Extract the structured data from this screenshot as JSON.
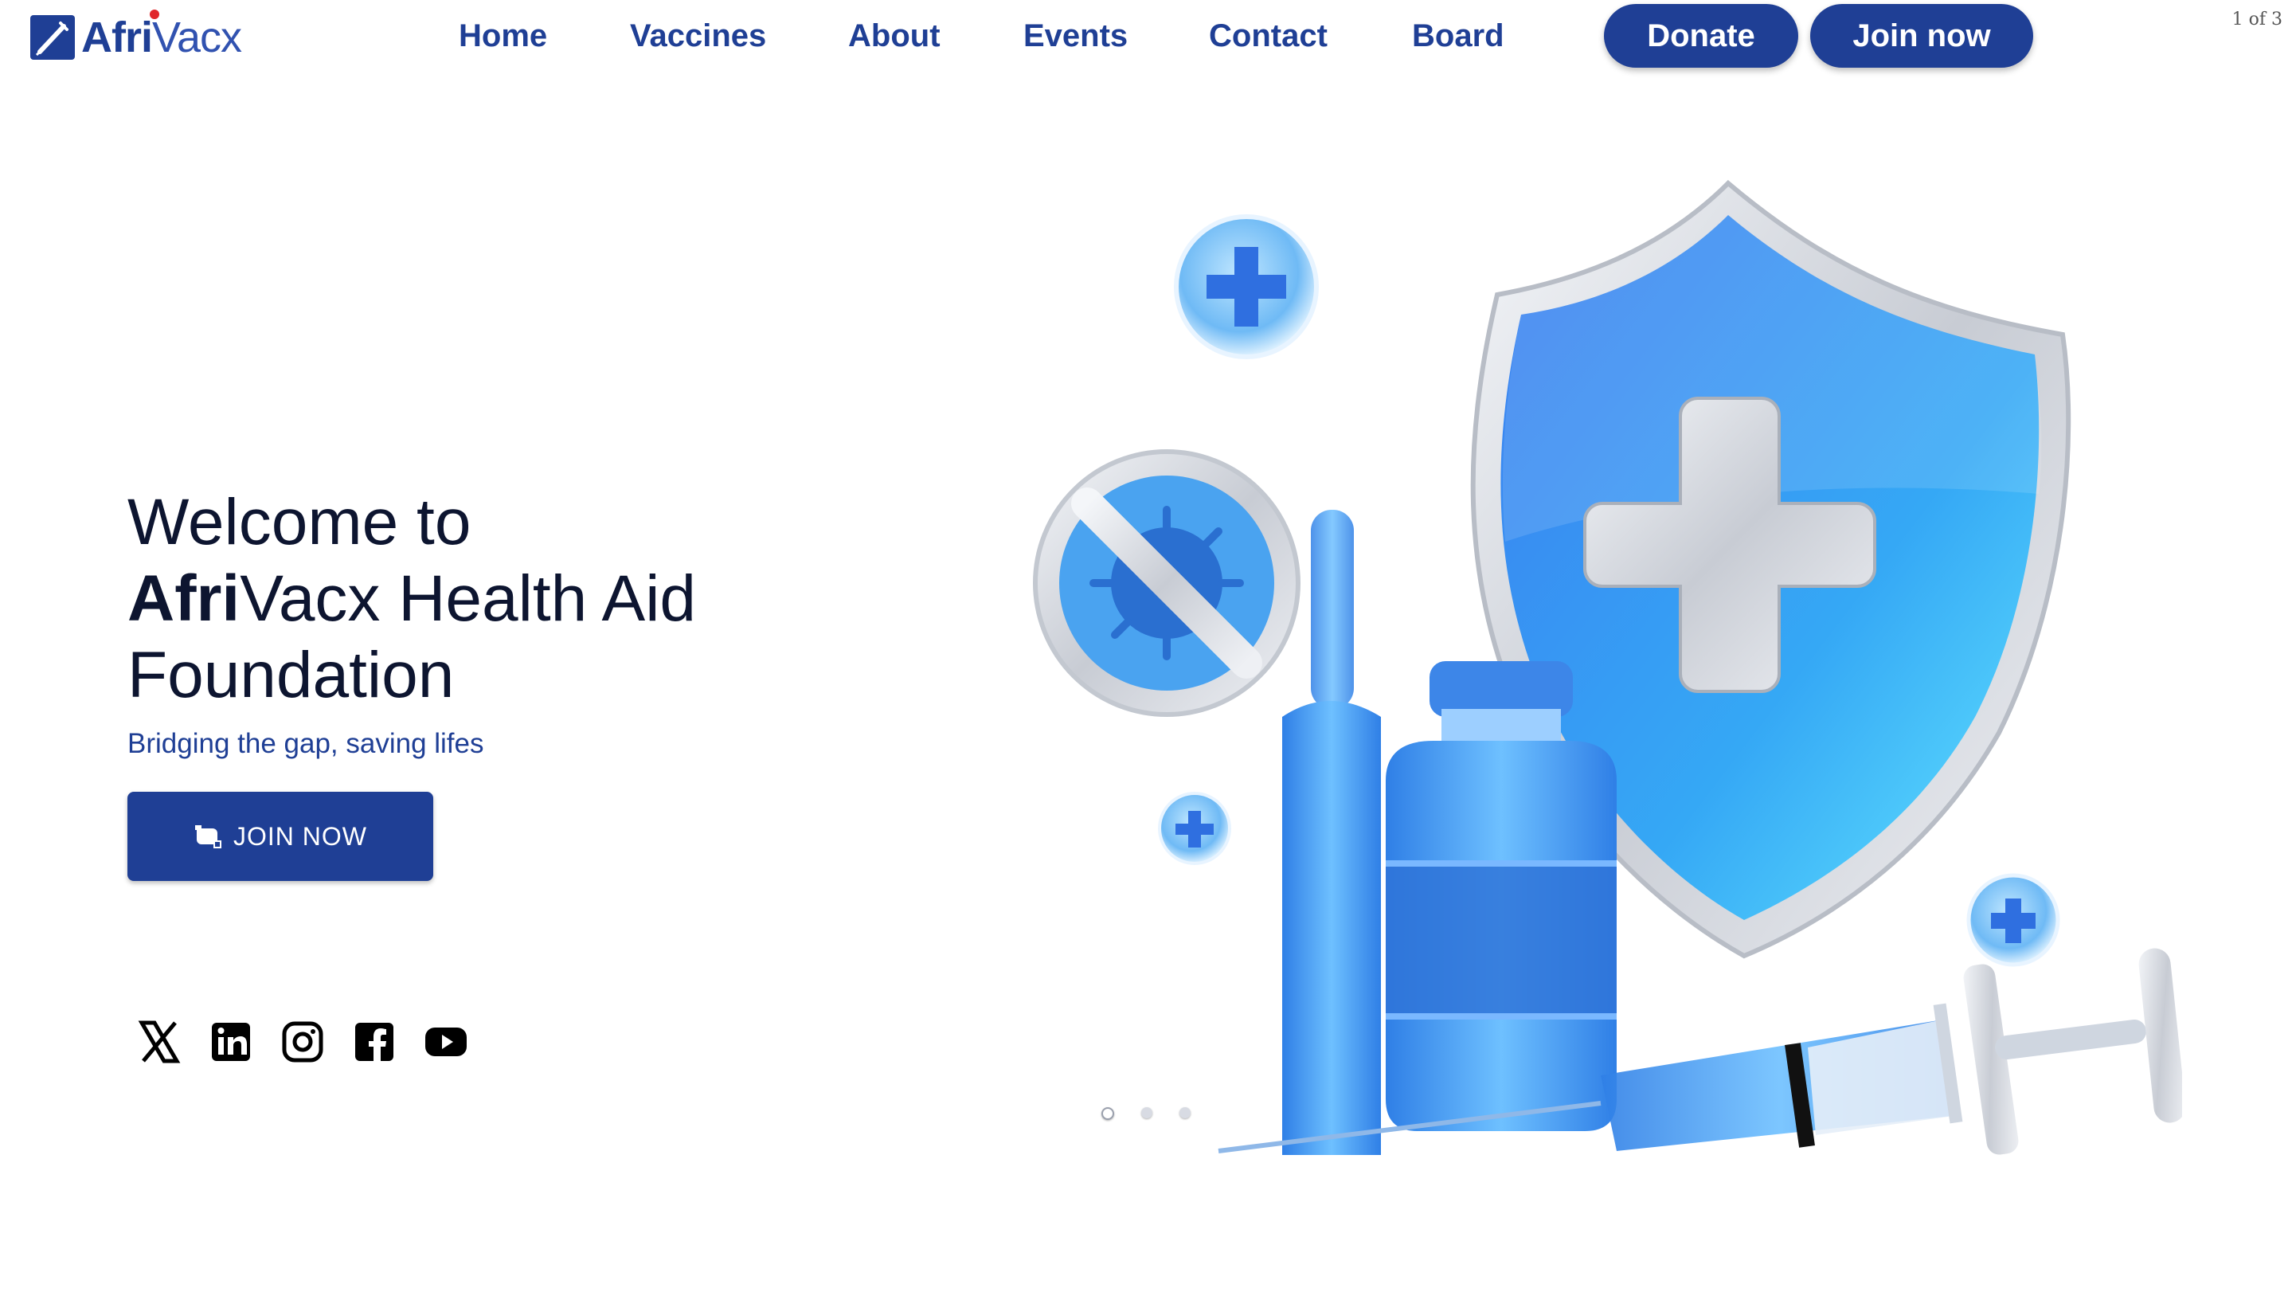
{
  "brand": {
    "name_bold": "Afri",
    "name_light": "Vacx"
  },
  "nav": {
    "items": [
      "Home",
      "Vaccines",
      "About",
      "Events",
      "Contact",
      "Board"
    ],
    "donate_label": "Donate",
    "join_label": "Join now"
  },
  "slider": {
    "counter": "1 of 3",
    "active_slide": 1,
    "total_slides": 3
  },
  "hero": {
    "title_line1": "Welcome to",
    "title_brand_bold": "Afri",
    "title_brand_rest": "Vacx Health Aid",
    "title_line3": "Foundation",
    "tagline": "Bridging the gap, saving lifes",
    "cta_label": "JOIN NOW"
  },
  "social": [
    "x-icon",
    "linkedin-icon",
    "instagram-icon",
    "facebook-icon",
    "youtube-icon"
  ],
  "colors": {
    "primary": "#1f3f95",
    "text_dark": "#0d1530",
    "accent_blue": "#2f8ff0",
    "accent_red": "#e0262a"
  }
}
